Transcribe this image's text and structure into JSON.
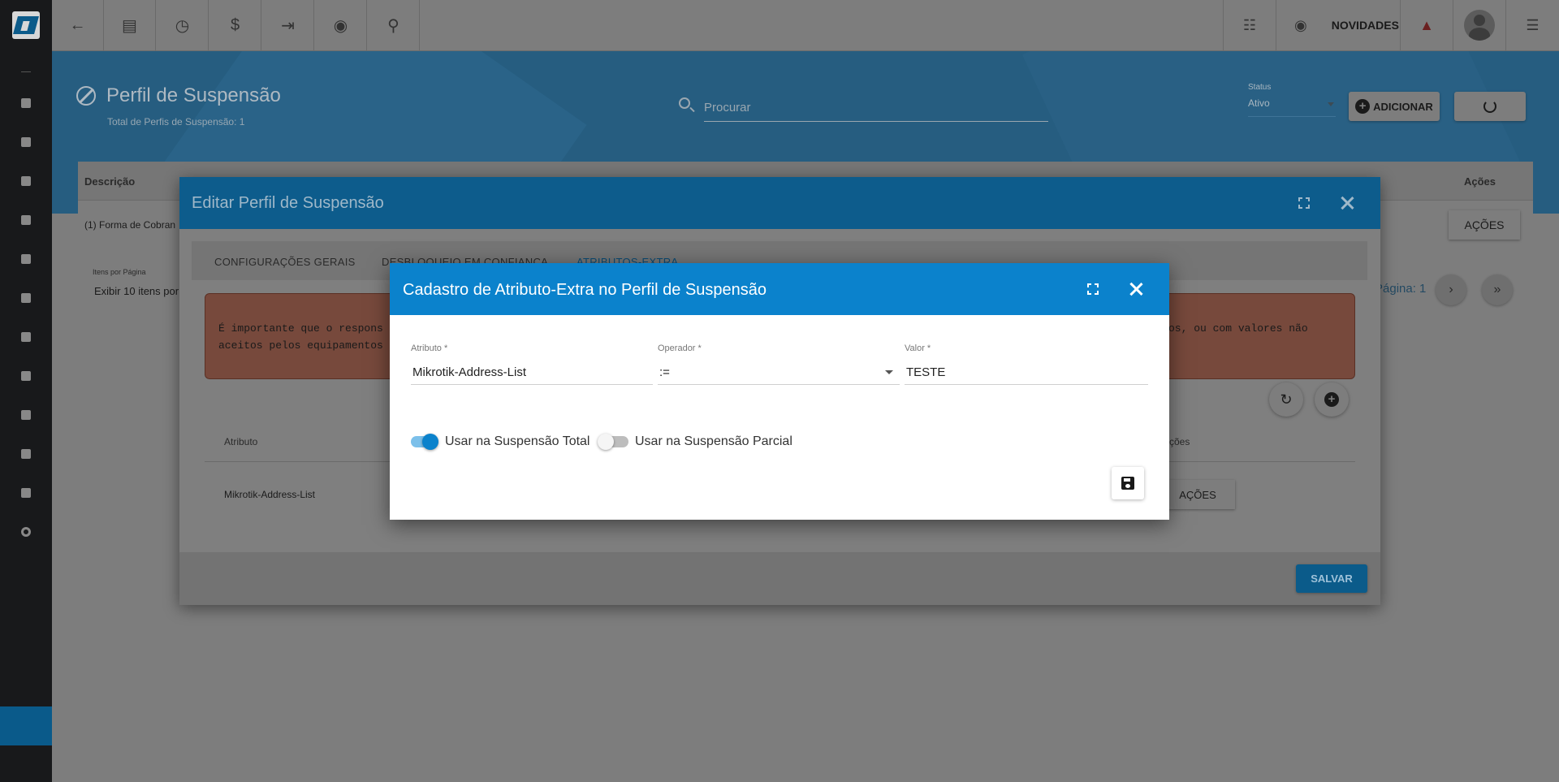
{
  "sidebar": {
    "items": [
      "dashboard-icon",
      "chart-icon",
      "contacts-icon",
      "board-icon",
      "calendar-icon",
      "box-icon",
      "money-icon",
      "location-icon",
      "list-icon",
      "server-icon",
      "document-icon",
      "gear-icon"
    ]
  },
  "topbar": {
    "novidades_label": "NOVIDADES"
  },
  "header": {
    "title": "Perfil de Suspensão",
    "subtitle": "Total de Perfis de Suspensão: 1",
    "search_placeholder": "Procurar",
    "status_label": "Status",
    "status_value": "Ativo",
    "add_label": "ADICIONAR"
  },
  "background_table": {
    "col_descricao": "Descrição",
    "col_acoes": "Ações",
    "row_text": "(1) Forma de Cobran",
    "row_acoes": "AÇÕES",
    "items_per_page_label": "Itens por Página",
    "items_per_page_value": "Exibir 10 itens por",
    "pagina": "Página: 1"
  },
  "modal_edit": {
    "title": "Editar Perfil de Suspensão",
    "tabs": [
      "CONFIGURAÇÕES GERAIS",
      "DESBLOQUEIO EM CONFIANÇA",
      "ATRIBUTOS-EXTRA"
    ],
    "warning_left": "É importante que o respons aceitos pelos equipamentos",
    "warning_right": "os, ou com valores não",
    "col_atributo": "Atributo",
    "col_acoes": "ções",
    "row_atributo": "Mikrotik-Address-List",
    "row_acoes": "AÇÕES",
    "save_label": "SALVAR"
  },
  "modal_cadastro": {
    "title": "Cadastro de Atributo-Extra no Perfil de Suspensão",
    "atributo_label": "Atributo *",
    "atributo_value": "Mikrotik-Address-List",
    "operador_label": "Operador *",
    "operador_value": ":=",
    "valor_label": "Valor *",
    "valor_value": "TESTE",
    "toggle_total_label": "Usar na Suspensão Total",
    "toggle_total_on": true,
    "toggle_parcial_label": "Usar na Suspensão Parcial",
    "toggle_parcial_on": false
  },
  "colors": {
    "modal_header": "#0b82cc",
    "toggle_on": "#0b82cc",
    "save_button": "#0b5b8a"
  }
}
